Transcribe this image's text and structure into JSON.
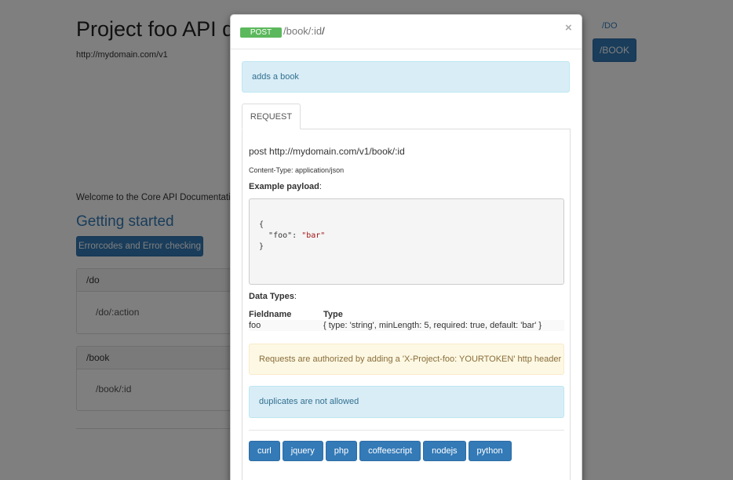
{
  "page": {
    "title": "Project foo API documentation",
    "base_url": "http://mydomain.com/v1",
    "welcome": "Welcome to the Core API Documentation.",
    "getting_started": "Getting started",
    "errorcodes_button": "Errorcodes and Error checking",
    "panels": [
      {
        "heading": "/do",
        "item": "/do/:action"
      },
      {
        "heading": "/book",
        "item": "/book/:id"
      }
    ],
    "nav": {
      "link": "/DO",
      "button": "/BOOK"
    }
  },
  "modal": {
    "method": "POST",
    "path": "/book/:id",
    "path_suffix": "/",
    "close": "×",
    "description": "adds a book",
    "tab": "REQUEST",
    "request_line": "post http://mydomain.com/v1/book/:id",
    "content_type": "Content-Type: application/json",
    "example_label": "Example payload",
    "example_code": {
      "open": "{",
      "key": "\"foo\"",
      "colon": ": ",
      "value": "\"bar\"",
      "close": "}"
    },
    "data_types_label": "Data Types",
    "table": {
      "headers": [
        "Fieldname",
        "Type"
      ],
      "rows": [
        {
          "field": "foo",
          "type": "{ type: 'string', minLength: 5, required: true, default: 'bar' }"
        }
      ]
    },
    "auth_note": "Requests are authorized by adding a 'X-Project-foo: YOURTOKEN' http header",
    "duplicates_note": "duplicates are not allowed",
    "languages": [
      "curl",
      "jquery",
      "php",
      "coffeescript",
      "nodejs",
      "python"
    ]
  },
  "colors": {
    "primary": "#337ab7",
    "success": "#5cb85c",
    "info_bg": "#d9edf7",
    "warning_bg": "#fcf8e3"
  }
}
